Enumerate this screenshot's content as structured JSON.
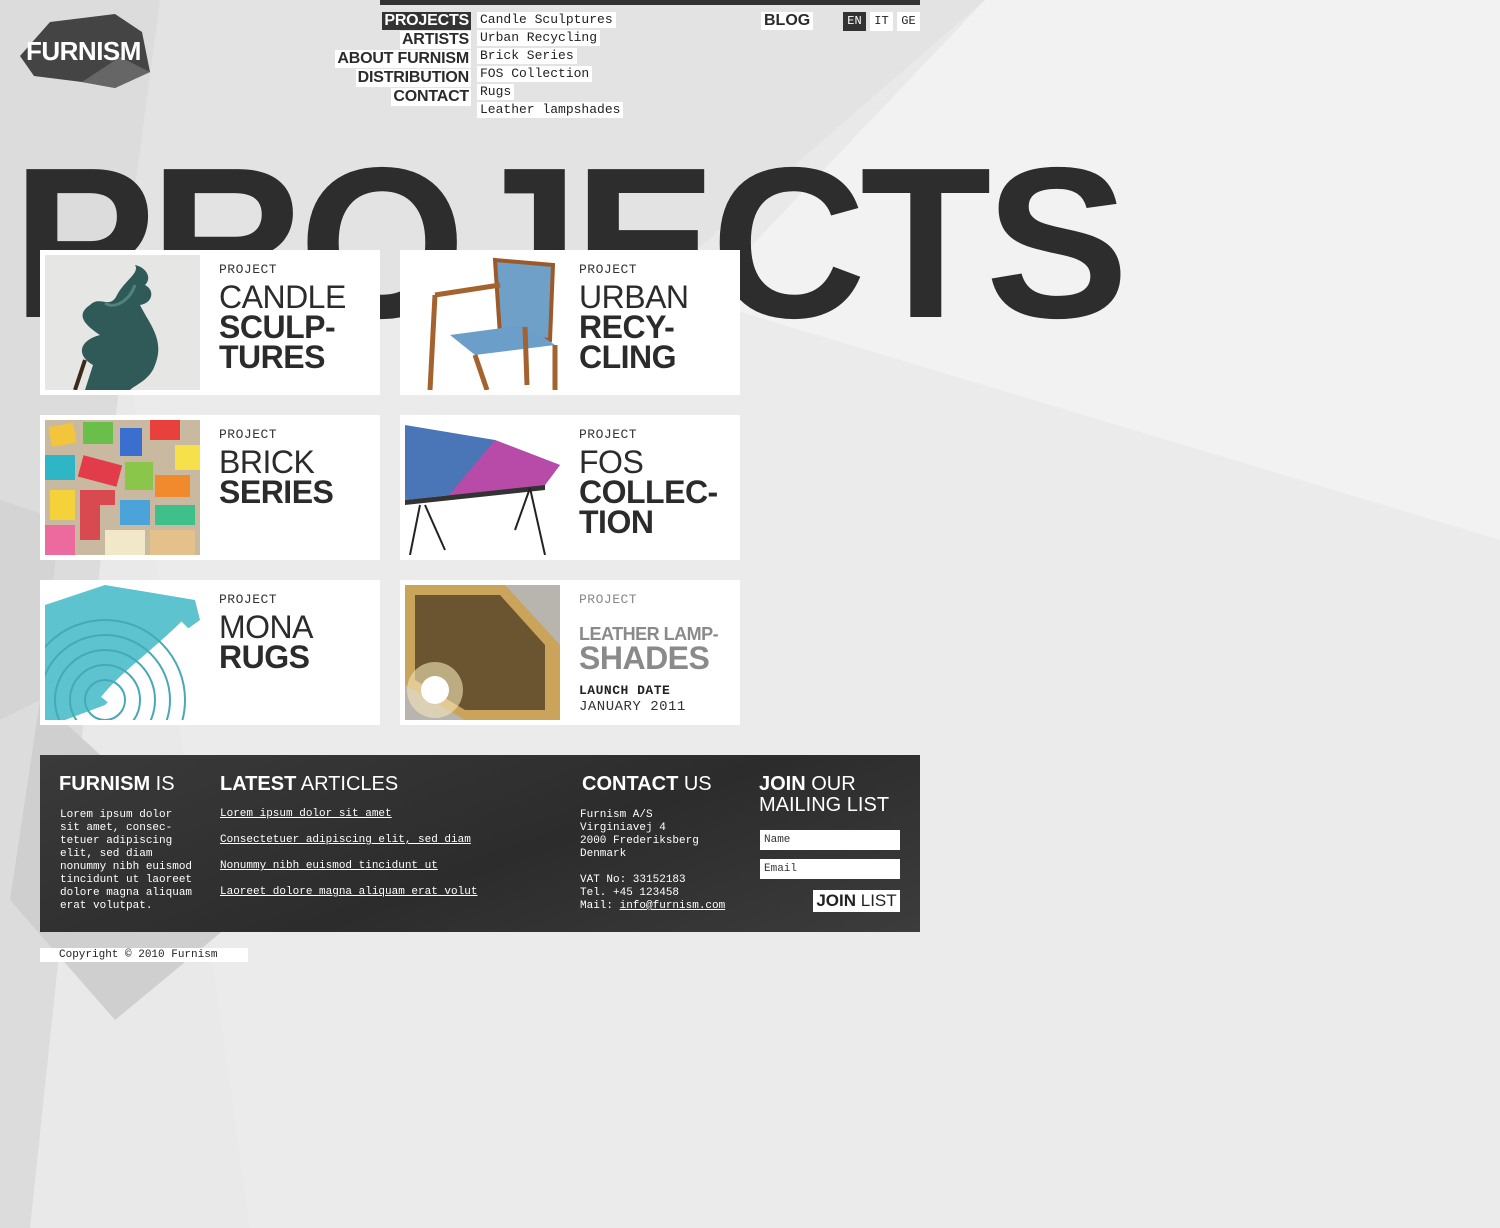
{
  "brand": {
    "logo_text": "FURNISM"
  },
  "nav": {
    "main": [
      {
        "label": "PROJECTS",
        "active": true
      },
      {
        "label": "ARTISTS",
        "active": false
      },
      {
        "label": "ABOUT FURNISM",
        "active": false
      },
      {
        "label": "DISTRIBUTION",
        "active": false
      },
      {
        "label": "CONTACT",
        "active": false
      }
    ],
    "sub": [
      "Candle Sculptures",
      "Urban Recycling",
      "Brick Series",
      "FOS Collection",
      "Rugs",
      "Leather lampshades"
    ],
    "blog": "BLOG",
    "languages": [
      {
        "code": "EN",
        "active": true
      },
      {
        "code": "IT",
        "active": false
      },
      {
        "code": "GE",
        "active": false
      }
    ]
  },
  "page_title": "PROJECTS",
  "projects": [
    {
      "kicker": "PROJECT",
      "title_light": "CANDLE",
      "title_bold": "SCULP-\nTURES",
      "image": "dark-green-ceramic-sculpture"
    },
    {
      "kicker": "PROJECT",
      "title_light": "URBAN",
      "title_bold": "RECY-\nCLING",
      "image": "wooden-chair-blue-upholstery"
    },
    {
      "kicker": "PROJECT",
      "title_light": "BRICK",
      "title_bold": "SERIES",
      "image": "colorful-wooden-blocks"
    },
    {
      "kicker": "PROJECT",
      "title_light": "FOS",
      "title_bold": "COLLEC-\nTION",
      "image": "geometric-table-top"
    },
    {
      "kicker": "PROJECT",
      "title_light": "MONA",
      "title_bold": "RUGS",
      "image": "turquoise-rug"
    },
    {
      "kicker": "PROJECT",
      "title_light": "LEATHER LAMP-",
      "title_bold": "SHADES",
      "image": "leather-lampshade",
      "launch_label": "LAUNCH DATE",
      "launch_date": "JANUARY 2011"
    }
  ],
  "footer": {
    "about": {
      "heading_bold": "FURNISM",
      "heading_light": " IS",
      "text": "Lorem ipsum dolor\nsit amet, consec-\ntetuer adipiscing\nelit, sed diam\nnonummy nibh euismod\ntincidunt ut laoreet\ndolore magna aliquam\nerat volutpat."
    },
    "articles": {
      "heading_bold": "LATEST",
      "heading_light": " ARTICLES",
      "items": [
        "Lorem ipsum dolor sit amet",
        "Consectetuer adipiscing elit, sed diam",
        "Nonummy nibh euismod tincidunt ut",
        "Laoreet dolore magna aliquam erat volut"
      ]
    },
    "contact": {
      "heading_bold": "CONTACT",
      "heading_light": " US",
      "address": "Furnism A/S\nVirginiavej 4\n2000 Frederiksberg\nDenmark",
      "vat": "VAT No: 33152183",
      "tel": "Tel. +45 123458",
      "mail_label": "Mail: ",
      "mail": "info@furnism.com"
    },
    "mailing": {
      "heading_bold": "JOIN",
      "heading_light": " OUR",
      "heading_line2": "MAILING LIST",
      "name_placeholder": "Name",
      "email_placeholder": "Email",
      "button_bold": "JOIN",
      "button_light": " LIST"
    }
  },
  "copyright": "Copyright © 2010 Furnism",
  "colors": {
    "dark": "#2b2b2b",
    "background": "#e9e9e9",
    "dim_text": "#8a8a8a"
  }
}
